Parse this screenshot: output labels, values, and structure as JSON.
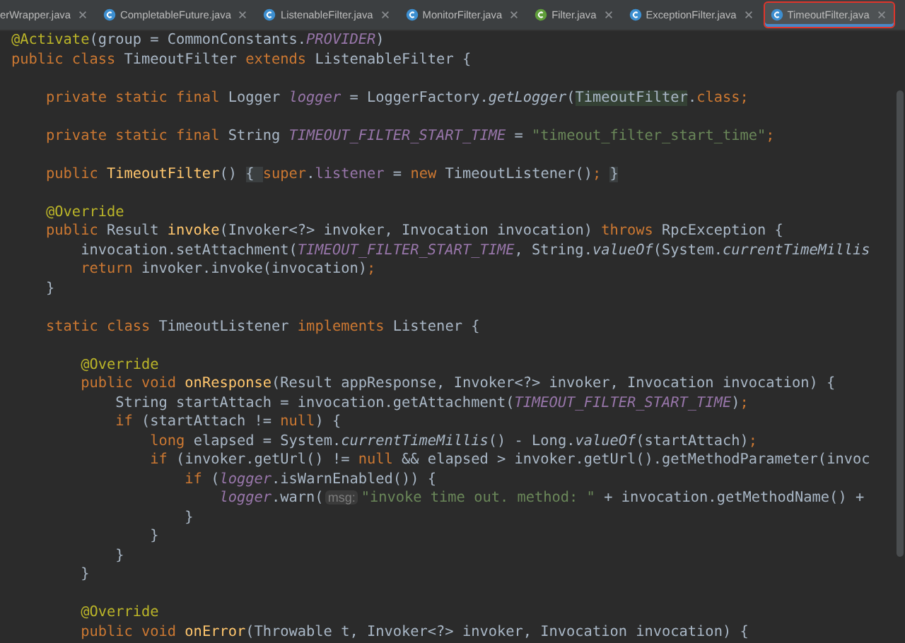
{
  "tabs": [
    {
      "label": "erWrapper.java",
      "selected": false
    },
    {
      "label": "CompletableFuture.java",
      "kind": "class",
      "selected": false
    },
    {
      "label": "ListenableFilter.java",
      "kind": "class",
      "selected": false
    },
    {
      "label": "MonitorFilter.java",
      "kind": "class",
      "selected": false
    },
    {
      "label": "Filter.java",
      "kind": "interface",
      "selected": false
    },
    {
      "label": "ExceptionFilter.java",
      "kind": "class",
      "selected": false
    },
    {
      "label": "TimeoutFilter.java",
      "kind": "class",
      "selected": true
    }
  ],
  "code": {
    "lines": [
      {
        "kind": "code",
        "tokens": [
          {
            "t": "@Activate",
            "kind": "ann"
          },
          {
            "t": "(group = CommonConstants.",
            "kind": "plain"
          },
          {
            "t": "PROVIDER",
            "kind": "field"
          },
          {
            "t": ")",
            "kind": "plain"
          }
        ]
      },
      {
        "kind": "code",
        "tokens": [
          {
            "t": "public class ",
            "kind": "kw"
          },
          {
            "t": "TimeoutFilter ",
            "kind": "plain"
          },
          {
            "t": "extends ",
            "kind": "kw"
          },
          {
            "t": "ListenableFilter {",
            "kind": "plain"
          }
        ]
      },
      {
        "kind": "blank"
      },
      {
        "kind": "code",
        "tokens": [
          {
            "t": "    private static final ",
            "kind": "kw"
          },
          {
            "t": "Logger ",
            "kind": "plain"
          },
          {
            "t": "logger",
            "kind": "field"
          },
          {
            "t": " = LoggerFactory.",
            "kind": "plain"
          },
          {
            "t": "getLogger",
            "kind": "static"
          },
          {
            "t": "(",
            "kind": "plain"
          },
          {
            "t": "TimeoutFilter",
            "kind": "usage"
          },
          {
            "t": ".",
            "kind": "plain"
          },
          {
            "t": "class",
            "kind": "kw"
          },
          {
            "t": ";",
            "kind": "kw"
          }
        ]
      },
      {
        "kind": "blank"
      },
      {
        "kind": "code",
        "tokens": [
          {
            "t": "    private static final ",
            "kind": "kw"
          },
          {
            "t": "String ",
            "kind": "plain"
          },
          {
            "t": "TIMEOUT_FILTER_START_TIME",
            "kind": "field"
          },
          {
            "t": " = ",
            "kind": "plain"
          },
          {
            "t": "\"timeout_filter_start_time\"",
            "kind": "str"
          },
          {
            "t": ";",
            "kind": "kw"
          }
        ]
      },
      {
        "kind": "blank"
      },
      {
        "kind": "code",
        "tokens": [
          {
            "t": "    public ",
            "kind": "kw"
          },
          {
            "t": "TimeoutFilter",
            "kind": "decl"
          },
          {
            "t": "() ",
            "kind": "plain"
          },
          {
            "t": "{ ",
            "kind": "fold"
          },
          {
            "t": "super",
            "kind": "kw"
          },
          {
            "t": ".",
            "kind": "plain"
          },
          {
            "t": "listener",
            "kind": "member"
          },
          {
            "t": " = ",
            "kind": "plain"
          },
          {
            "t": "new ",
            "kind": "kw"
          },
          {
            "t": "TimeoutListener()",
            "kind": "plain"
          },
          {
            "t": "; ",
            "kind": "kw"
          },
          {
            "t": "}",
            "kind": "fold"
          }
        ]
      },
      {
        "kind": "blank"
      },
      {
        "kind": "code",
        "tokens": [
          {
            "t": "    @Override",
            "kind": "ann"
          }
        ]
      },
      {
        "kind": "code",
        "tokens": [
          {
            "t": "    public ",
            "kind": "kw"
          },
          {
            "t": "Result ",
            "kind": "plain"
          },
          {
            "t": "invoke",
            "kind": "decl"
          },
          {
            "t": "(Invoker<?> invoker, Invocation invocation) ",
            "kind": "plain"
          },
          {
            "t": "throws ",
            "kind": "kw"
          },
          {
            "t": "RpcException {",
            "kind": "plain"
          }
        ]
      },
      {
        "kind": "code",
        "tokens": [
          {
            "t": "        invocation.setAttachment(",
            "kind": "plain"
          },
          {
            "t": "TIMEOUT_FILTER_START_TIME",
            "kind": "field"
          },
          {
            "t": ", String.",
            "kind": "plain"
          },
          {
            "t": "valueOf",
            "kind": "static"
          },
          {
            "t": "(System.",
            "kind": "plain"
          },
          {
            "t": "currentTimeMillis",
            "kind": "static"
          }
        ]
      },
      {
        "kind": "code",
        "tokens": [
          {
            "t": "        return ",
            "kind": "kw"
          },
          {
            "t": "invoker.invoke(invocation)",
            "kind": "plain"
          },
          {
            "t": ";",
            "kind": "kw"
          }
        ]
      },
      {
        "kind": "code",
        "tokens": [
          {
            "t": "    }",
            "kind": "plain"
          }
        ]
      },
      {
        "kind": "blank"
      },
      {
        "kind": "code",
        "tokens": [
          {
            "t": "    static class ",
            "kind": "kw"
          },
          {
            "t": "TimeoutListener ",
            "kind": "plain"
          },
          {
            "t": "implements ",
            "kind": "kw"
          },
          {
            "t": "Listener {",
            "kind": "plain"
          }
        ]
      },
      {
        "kind": "blank"
      },
      {
        "kind": "code",
        "tokens": [
          {
            "t": "        @Override",
            "kind": "ann"
          }
        ]
      },
      {
        "kind": "code",
        "tokens": [
          {
            "t": "        public void ",
            "kind": "kw"
          },
          {
            "t": "onResponse",
            "kind": "decl"
          },
          {
            "t": "(Result appResponse, Invoker<?> invoker, Invocation invocation) {",
            "kind": "plain"
          }
        ]
      },
      {
        "kind": "code",
        "tokens": [
          {
            "t": "            String startAttach = invocation.getAttachment(",
            "kind": "plain"
          },
          {
            "t": "TIMEOUT_FILTER_START_TIME",
            "kind": "field"
          },
          {
            "t": ")",
            "kind": "plain"
          },
          {
            "t": ";",
            "kind": "kw"
          }
        ]
      },
      {
        "kind": "code",
        "tokens": [
          {
            "t": "            if ",
            "kind": "kw"
          },
          {
            "t": "(startAttach != ",
            "kind": "plain"
          },
          {
            "t": "null",
            "kind": "kw"
          },
          {
            "t": ") {",
            "kind": "plain"
          }
        ]
      },
      {
        "kind": "code",
        "tokens": [
          {
            "t": "                long ",
            "kind": "kw"
          },
          {
            "t": "elapsed = System.",
            "kind": "plain"
          },
          {
            "t": "currentTimeMillis",
            "kind": "static"
          },
          {
            "t": "() - Long.",
            "kind": "plain"
          },
          {
            "t": "valueOf",
            "kind": "static"
          },
          {
            "t": "(startAttach)",
            "kind": "plain"
          },
          {
            "t": ";",
            "kind": "kw"
          }
        ]
      },
      {
        "kind": "code",
        "tokens": [
          {
            "t": "                if ",
            "kind": "kw"
          },
          {
            "t": "(invoker.getUrl() != ",
            "kind": "plain"
          },
          {
            "t": "null ",
            "kind": "kw"
          },
          {
            "t": "&& elapsed > invoker.getUrl().getMethodParameter(invoc",
            "kind": "plain"
          }
        ]
      },
      {
        "kind": "code",
        "tokens": [
          {
            "t": "                    if ",
            "kind": "kw"
          },
          {
            "t": "(",
            "kind": "plain"
          },
          {
            "t": "logger",
            "kind": "field"
          },
          {
            "t": ".isWarnEnabled()) {",
            "kind": "plain"
          }
        ]
      },
      {
        "kind": "code",
        "tokens": [
          {
            "t": "                        logger",
            "kind": "field"
          },
          {
            "t": ".warn(",
            "kind": "plain"
          },
          {
            "t": "msg:",
            "kind": "hint"
          },
          {
            "t": "\"invoke time out. method: \"",
            "kind": "str"
          },
          {
            "t": " + invocation.getMethodName() +",
            "kind": "plain"
          }
        ]
      },
      {
        "kind": "code",
        "tokens": [
          {
            "t": "                    }",
            "kind": "plain"
          }
        ]
      },
      {
        "kind": "code",
        "tokens": [
          {
            "t": "                }",
            "kind": "plain"
          }
        ]
      },
      {
        "kind": "code",
        "tokens": [
          {
            "t": "            }",
            "kind": "plain"
          }
        ]
      },
      {
        "kind": "code",
        "tokens": [
          {
            "t": "        }",
            "kind": "plain"
          }
        ]
      },
      {
        "kind": "blank"
      },
      {
        "kind": "code",
        "tokens": [
          {
            "t": "        @Override",
            "kind": "ann"
          }
        ]
      },
      {
        "kind": "code",
        "tokens": [
          {
            "t": "        public void ",
            "kind": "kw"
          },
          {
            "t": "onError",
            "kind": "decl"
          },
          {
            "t": "(Throwable t, Invoker<?> invoker, Invocation invocation) {",
            "kind": "plain"
          }
        ]
      }
    ]
  }
}
